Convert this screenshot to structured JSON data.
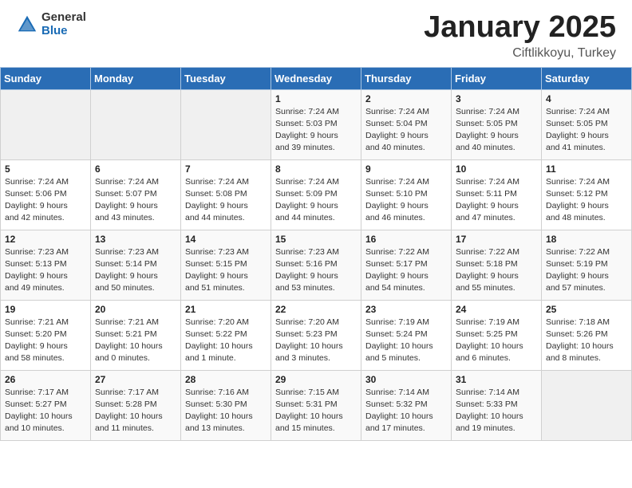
{
  "header": {
    "logo_general": "General",
    "logo_blue": "Blue",
    "month_year": "January 2025",
    "location": "Ciftlikkoyu, Turkey"
  },
  "days_of_week": [
    "Sunday",
    "Monday",
    "Tuesday",
    "Wednesday",
    "Thursday",
    "Friday",
    "Saturday"
  ],
  "weeks": [
    [
      {
        "day": "",
        "info": ""
      },
      {
        "day": "",
        "info": ""
      },
      {
        "day": "",
        "info": ""
      },
      {
        "day": "1",
        "info": "Sunrise: 7:24 AM\nSunset: 5:03 PM\nDaylight: 9 hours\nand 39 minutes."
      },
      {
        "day": "2",
        "info": "Sunrise: 7:24 AM\nSunset: 5:04 PM\nDaylight: 9 hours\nand 40 minutes."
      },
      {
        "day": "3",
        "info": "Sunrise: 7:24 AM\nSunset: 5:05 PM\nDaylight: 9 hours\nand 40 minutes."
      },
      {
        "day": "4",
        "info": "Sunrise: 7:24 AM\nSunset: 5:05 PM\nDaylight: 9 hours\nand 41 minutes."
      }
    ],
    [
      {
        "day": "5",
        "info": "Sunrise: 7:24 AM\nSunset: 5:06 PM\nDaylight: 9 hours\nand 42 minutes."
      },
      {
        "day": "6",
        "info": "Sunrise: 7:24 AM\nSunset: 5:07 PM\nDaylight: 9 hours\nand 43 minutes."
      },
      {
        "day": "7",
        "info": "Sunrise: 7:24 AM\nSunset: 5:08 PM\nDaylight: 9 hours\nand 44 minutes."
      },
      {
        "day": "8",
        "info": "Sunrise: 7:24 AM\nSunset: 5:09 PM\nDaylight: 9 hours\nand 44 minutes."
      },
      {
        "day": "9",
        "info": "Sunrise: 7:24 AM\nSunset: 5:10 PM\nDaylight: 9 hours\nand 46 minutes."
      },
      {
        "day": "10",
        "info": "Sunrise: 7:24 AM\nSunset: 5:11 PM\nDaylight: 9 hours\nand 47 minutes."
      },
      {
        "day": "11",
        "info": "Sunrise: 7:24 AM\nSunset: 5:12 PM\nDaylight: 9 hours\nand 48 minutes."
      }
    ],
    [
      {
        "day": "12",
        "info": "Sunrise: 7:23 AM\nSunset: 5:13 PM\nDaylight: 9 hours\nand 49 minutes."
      },
      {
        "day": "13",
        "info": "Sunrise: 7:23 AM\nSunset: 5:14 PM\nDaylight: 9 hours\nand 50 minutes."
      },
      {
        "day": "14",
        "info": "Sunrise: 7:23 AM\nSunset: 5:15 PM\nDaylight: 9 hours\nand 51 minutes."
      },
      {
        "day": "15",
        "info": "Sunrise: 7:23 AM\nSunset: 5:16 PM\nDaylight: 9 hours\nand 53 minutes."
      },
      {
        "day": "16",
        "info": "Sunrise: 7:22 AM\nSunset: 5:17 PM\nDaylight: 9 hours\nand 54 minutes."
      },
      {
        "day": "17",
        "info": "Sunrise: 7:22 AM\nSunset: 5:18 PM\nDaylight: 9 hours\nand 55 minutes."
      },
      {
        "day": "18",
        "info": "Sunrise: 7:22 AM\nSunset: 5:19 PM\nDaylight: 9 hours\nand 57 minutes."
      }
    ],
    [
      {
        "day": "19",
        "info": "Sunrise: 7:21 AM\nSunset: 5:20 PM\nDaylight: 9 hours\nand 58 minutes."
      },
      {
        "day": "20",
        "info": "Sunrise: 7:21 AM\nSunset: 5:21 PM\nDaylight: 10 hours\nand 0 minutes."
      },
      {
        "day": "21",
        "info": "Sunrise: 7:20 AM\nSunset: 5:22 PM\nDaylight: 10 hours\nand 1 minute."
      },
      {
        "day": "22",
        "info": "Sunrise: 7:20 AM\nSunset: 5:23 PM\nDaylight: 10 hours\nand 3 minutes."
      },
      {
        "day": "23",
        "info": "Sunrise: 7:19 AM\nSunset: 5:24 PM\nDaylight: 10 hours\nand 5 minutes."
      },
      {
        "day": "24",
        "info": "Sunrise: 7:19 AM\nSunset: 5:25 PM\nDaylight: 10 hours\nand 6 minutes."
      },
      {
        "day": "25",
        "info": "Sunrise: 7:18 AM\nSunset: 5:26 PM\nDaylight: 10 hours\nand 8 minutes."
      }
    ],
    [
      {
        "day": "26",
        "info": "Sunrise: 7:17 AM\nSunset: 5:27 PM\nDaylight: 10 hours\nand 10 minutes."
      },
      {
        "day": "27",
        "info": "Sunrise: 7:17 AM\nSunset: 5:28 PM\nDaylight: 10 hours\nand 11 minutes."
      },
      {
        "day": "28",
        "info": "Sunrise: 7:16 AM\nSunset: 5:30 PM\nDaylight: 10 hours\nand 13 minutes."
      },
      {
        "day": "29",
        "info": "Sunrise: 7:15 AM\nSunset: 5:31 PM\nDaylight: 10 hours\nand 15 minutes."
      },
      {
        "day": "30",
        "info": "Sunrise: 7:14 AM\nSunset: 5:32 PM\nDaylight: 10 hours\nand 17 minutes."
      },
      {
        "day": "31",
        "info": "Sunrise: 7:14 AM\nSunset: 5:33 PM\nDaylight: 10 hours\nand 19 minutes."
      },
      {
        "day": "",
        "info": ""
      }
    ]
  ]
}
